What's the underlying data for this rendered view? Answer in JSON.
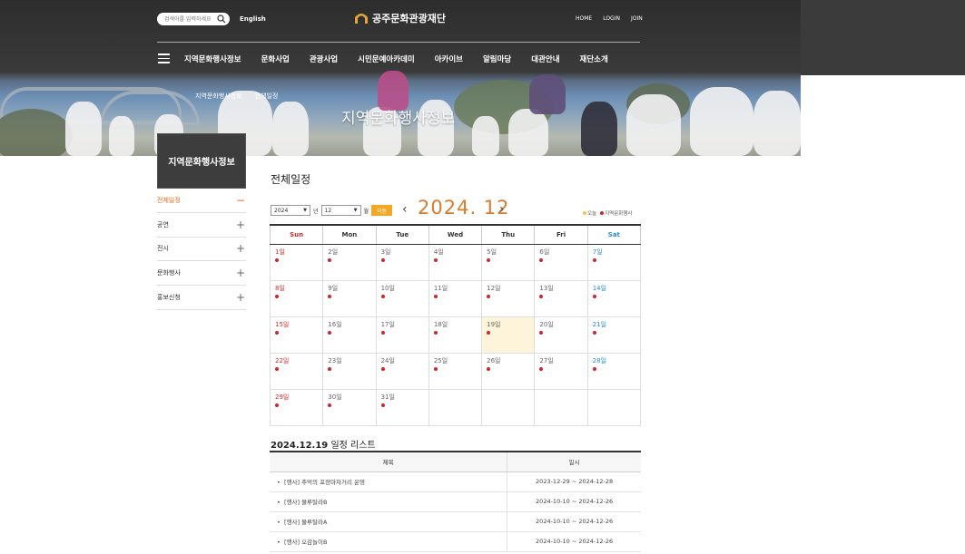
{
  "header": {
    "search_placeholder": "검색어를 입력하세요",
    "lang_link": "English",
    "logo_text": "공주문화관광재단",
    "util_nav": [
      "HOME",
      "LOGIN",
      "JOIN"
    ],
    "gnb": [
      "지역문화행사정보",
      "문화사업",
      "관광사업",
      "시민문예아카데미",
      "아카이브",
      "알림마당",
      "대관안내",
      "재단소개"
    ]
  },
  "hero": {
    "breadcrumb": [
      "지역문화행사정보",
      "전체일정"
    ],
    "title": "지역문화행사정보"
  },
  "sidebar": {
    "title": "지역문화행사정보",
    "items": [
      {
        "label": "전체일정",
        "sign": "−"
      },
      {
        "label": "공연",
        "sign": "+"
      },
      {
        "label": "전시",
        "sign": "+"
      },
      {
        "label": "문화행사",
        "sign": "+"
      },
      {
        "label": "홍보신청",
        "sign": "+"
      }
    ]
  },
  "content": {
    "title": "전체일정",
    "year_select": "2024",
    "year_unit": "년",
    "month_select": "12",
    "month_unit": "월",
    "move_button": "이동",
    "heading": "2024. 12",
    "prev": "‹",
    "next": "›",
    "legend": [
      {
        "label": "오늘",
        "color": "#f3c547"
      },
      {
        "label": "지역문화행사",
        "color": "#d0242e"
      }
    ]
  },
  "calendar": {
    "weekdays": [
      "Sun",
      "Mon",
      "Tue",
      "Wed",
      "Thu",
      "Fri",
      "Sat"
    ],
    "weeks": [
      [
        "1일",
        "2일",
        "3일",
        "4일",
        "5일",
        "6일",
        "7일"
      ],
      [
        "8일",
        "9일",
        "10일",
        "11일",
        "12일",
        "13일",
        "14일"
      ],
      [
        "15일",
        "16일",
        "17일",
        "18일",
        "19일",
        "20일",
        "21일"
      ],
      [
        "22일",
        "23일",
        "24일",
        "25일",
        "26일",
        "27일",
        "28일"
      ],
      [
        "29일",
        "30일",
        "31일",
        "",
        "",
        "",
        ""
      ]
    ],
    "today": "19일"
  },
  "schedule": {
    "title_date": "2024.12.19",
    "title_suffix": " 일정 리스트",
    "col_title": "제목",
    "col_date": "일시",
    "rows": [
      {
        "title": "[행사] 추억의 포장마차거리 운영",
        "date": "2023-12-29 ~ 2024-12-28"
      },
      {
        "title": "[행사] 물루탈라B",
        "date": "2024-10-10 ~ 2024-12-26"
      },
      {
        "title": "[행사] 물루탈라A",
        "date": "2024-10-10 ~ 2024-12-26"
      },
      {
        "title": "[행사] 오감놀이B",
        "date": "2024-10-10 ~ 2024-12-26"
      }
    ]
  }
}
